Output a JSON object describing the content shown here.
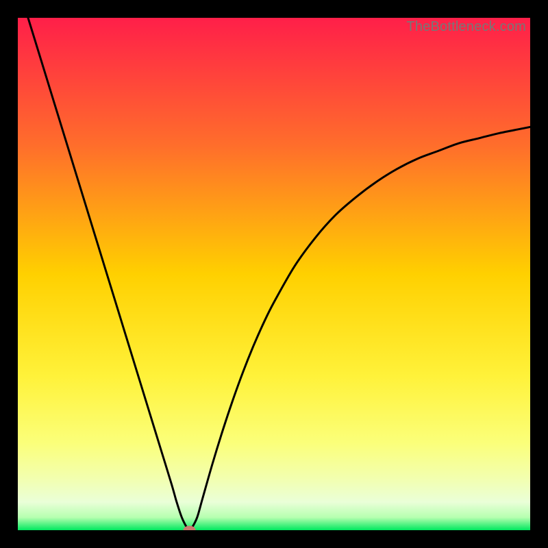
{
  "watermark": "TheBottleneck.com",
  "chart_data": {
    "type": "line",
    "title": "",
    "xlabel": "",
    "ylabel": "",
    "xlim": [
      0,
      100
    ],
    "ylim": [
      0,
      100
    ],
    "series": [
      {
        "name": "bottleneck-curve",
        "x": [
          2,
          4,
          6,
          8,
          10,
          12,
          14,
          16,
          18,
          20,
          22,
          24,
          26,
          28,
          30,
          31,
          32,
          33,
          33.5,
          34,
          35,
          36,
          38,
          40,
          42,
          44,
          46,
          48,
          50,
          54,
          58,
          62,
          66,
          70,
          74,
          78,
          82,
          86,
          90,
          94,
          98,
          100
        ],
        "y": [
          100,
          93.5,
          87,
          80.5,
          74,
          67.5,
          61,
          54.5,
          48,
          41.5,
          35,
          28.5,
          22,
          15.5,
          9,
          5.5,
          2.5,
          0.5,
          0,
          0.5,
          2.5,
          6,
          13,
          19.5,
          25.5,
          31,
          36,
          40.5,
          44.5,
          51.5,
          57,
          61.5,
          65,
          68,
          70.5,
          72.5,
          74,
          75.5,
          76.5,
          77.5,
          78.3,
          78.7
        ]
      }
    ],
    "marker": {
      "x": 33.5,
      "y": 0,
      "color": "#c97b6f"
    },
    "gradient": {
      "stops": [
        {
          "offset": 0.0,
          "color": "#ff1f49"
        },
        {
          "offset": 0.25,
          "color": "#ff6e2b"
        },
        {
          "offset": 0.5,
          "color": "#ffd000"
        },
        {
          "offset": 0.7,
          "color": "#fff23a"
        },
        {
          "offset": 0.83,
          "color": "#fbff7a"
        },
        {
          "offset": 0.9,
          "color": "#f2ffb0"
        },
        {
          "offset": 0.945,
          "color": "#eaffd8"
        },
        {
          "offset": 0.975,
          "color": "#b6ffb0"
        },
        {
          "offset": 1.0,
          "color": "#00e85f"
        }
      ]
    }
  }
}
